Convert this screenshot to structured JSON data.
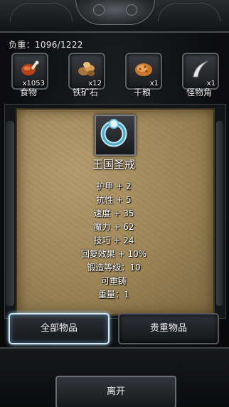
{
  "weight": {
    "label": "负重：1096/1222"
  },
  "slots": [
    {
      "icon": "meat-icon",
      "count": "x1053",
      "label": "食物"
    },
    {
      "icon": "iron-ore-icon",
      "count": "x12",
      "label": "铁矿石"
    },
    {
      "icon": "dried-food-icon",
      "count": "x1",
      "label": "干粮"
    },
    {
      "icon": "monster-horn-icon",
      "count": "x1",
      "label": "怪物角"
    }
  ],
  "item": {
    "icon": "ring-icon",
    "name": "王国圣戒",
    "stats": [
      "护甲 + 2",
      "抗性 + 5",
      "速度 + 35",
      "魔力 + 62",
      "技巧 + 24",
      "回复效果 + 10%",
      "锻造等级：10",
      "可重铸",
      "重量：1"
    ]
  },
  "tabs": {
    "all": "全部物品",
    "valuable": "贵重物品"
  },
  "leave": {
    "label": "离开"
  },
  "colors": {
    "parchment": "#a88f61",
    "active_glow": "#9fd6ff",
    "frame": "#5c6066"
  }
}
